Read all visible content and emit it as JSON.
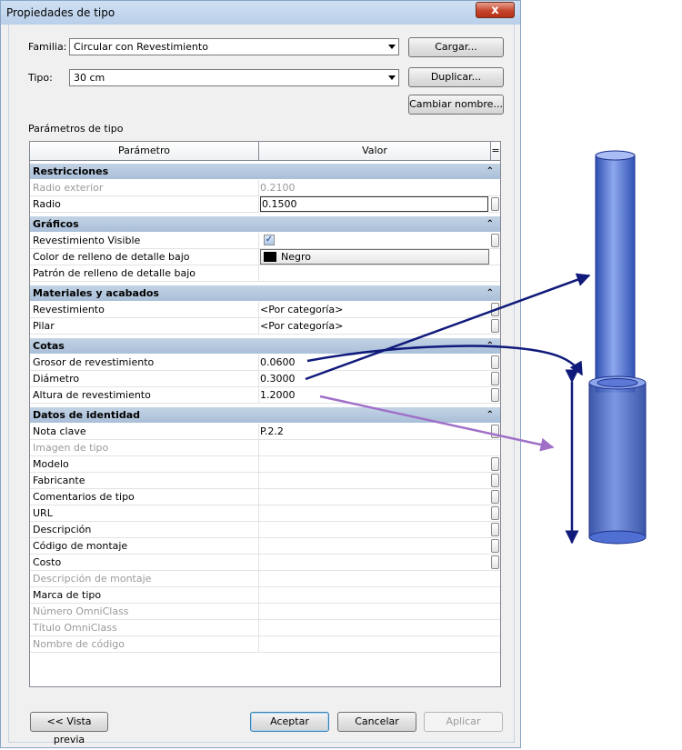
{
  "window": {
    "title": "Propiedades de tipo",
    "close_glyph": "x"
  },
  "form": {
    "familia_label": "Familia:",
    "familia_value": "Circular con Revestimiento",
    "tipo_label": "Tipo:",
    "tipo_value": "30 cm",
    "cargar_label": "Cargar...",
    "duplicar_label": "Duplicar...",
    "cambiar_nombre_label": "Cambiar nombre...",
    "parametros_label": "Parámetros de tipo"
  },
  "grid": {
    "col_parametro": "Parámetro",
    "col_valor": "Valor",
    "col_eq": "=",
    "groups": [
      {
        "name": "Restricciones",
        "chevron": "⌃"
      },
      {
        "name": "Gráficos",
        "chevron": "⌃"
      },
      {
        "name": "Materiales y acabados",
        "chevron": "⌃"
      },
      {
        "name": "Cotas",
        "chevron": "⌃"
      },
      {
        "name": "Datos de identidad",
        "chevron": "⌃"
      }
    ],
    "rows": [
      {
        "name": "Radio exterior",
        "value": "0.2100"
      },
      {
        "name": "Radio",
        "value": "0.1500"
      },
      {
        "name": "Revestimiento Visible",
        "value": "✓"
      },
      {
        "name": "Color de relleno de detalle bajo",
        "value": "Negro"
      },
      {
        "name": "Patrón de relleno de detalle bajo",
        "value": ""
      },
      {
        "name": "Revestimiento",
        "value": "<Por categoría>"
      },
      {
        "name": "Pilar",
        "value": "<Por categoría>"
      },
      {
        "name": "Grosor de revestimiento",
        "value": "0.0600"
      },
      {
        "name": "Diámetro",
        "value": "0.3000"
      },
      {
        "name": "Altura de revestimiento",
        "value": "1.2000"
      },
      {
        "name": "Nota clave",
        "value": "P.2.2"
      },
      {
        "name": "Imagen de tipo",
        "value": ""
      },
      {
        "name": "Modelo",
        "value": ""
      },
      {
        "name": "Fabricante",
        "value": ""
      },
      {
        "name": "Comentarios de tipo",
        "value": ""
      },
      {
        "name": "URL",
        "value": ""
      },
      {
        "name": "Descripción",
        "value": ""
      },
      {
        "name": "Código de montaje",
        "value": ""
      },
      {
        "name": "Costo",
        "value": ""
      },
      {
        "name": "Descripción de montaje",
        "value": ""
      },
      {
        "name": "Marca de tipo",
        "value": ""
      },
      {
        "name": "Número OmniClass",
        "value": ""
      },
      {
        "name": "Título OmniClass",
        "value": ""
      },
      {
        "name": "Nombre de código",
        "value": ""
      }
    ]
  },
  "footer": {
    "vista_previa_label": "<< Vista previa",
    "aceptar_label": "Aceptar",
    "cancelar_label": "Cancelar",
    "aplicar_label": "Aplicar"
  },
  "colors": {
    "group_header": "#b4c7dd",
    "arrow_navy": "#101a7a",
    "arrow_purple": "#a070c8",
    "cylinder_blue": "#4a6fd0"
  }
}
